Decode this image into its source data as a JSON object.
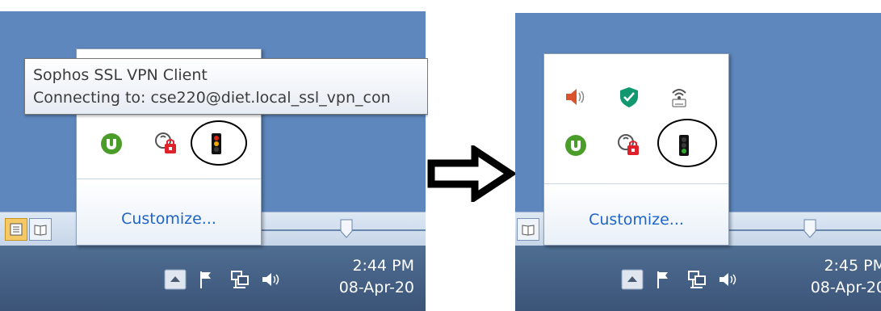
{
  "before": {
    "tooltip": {
      "title": "Sophos SSL VPN Client",
      "status": "Connecting to: cse220@diet.local_ssl_vpn_con"
    },
    "tray_popup": {
      "customize_label": "Customize...",
      "icons": [
        "utorrent-icon",
        "network-locked-icon",
        "vpn-traffic-light-yellow-icon"
      ]
    },
    "clock": {
      "time": "2:44 PM",
      "date": "08-Apr-20"
    },
    "system_icons": [
      "show-hidden-icons-button",
      "action-center-flag-icon",
      "network-icon",
      "volume-icon"
    ]
  },
  "after": {
    "tray_popup": {
      "customize_label": "Customize...",
      "icons": [
        "volume-muted-icon",
        "security-shield-icon",
        "wireless-icon",
        "utorrent-icon",
        "network-locked-icon",
        "vpn-traffic-light-green-icon"
      ]
    },
    "clock": {
      "time": "2:45 PM",
      "date": "08-Apr-20"
    },
    "system_icons": [
      "show-hidden-icons-button",
      "action-center-flag-icon",
      "network-icon",
      "volume-icon"
    ]
  },
  "colors": {
    "desktop": "#5d87bd",
    "taskbar": "#3b5478",
    "link": "#1e64c8",
    "vpn_connecting": "#f2a900",
    "vpn_connected": "#2ea82e"
  }
}
